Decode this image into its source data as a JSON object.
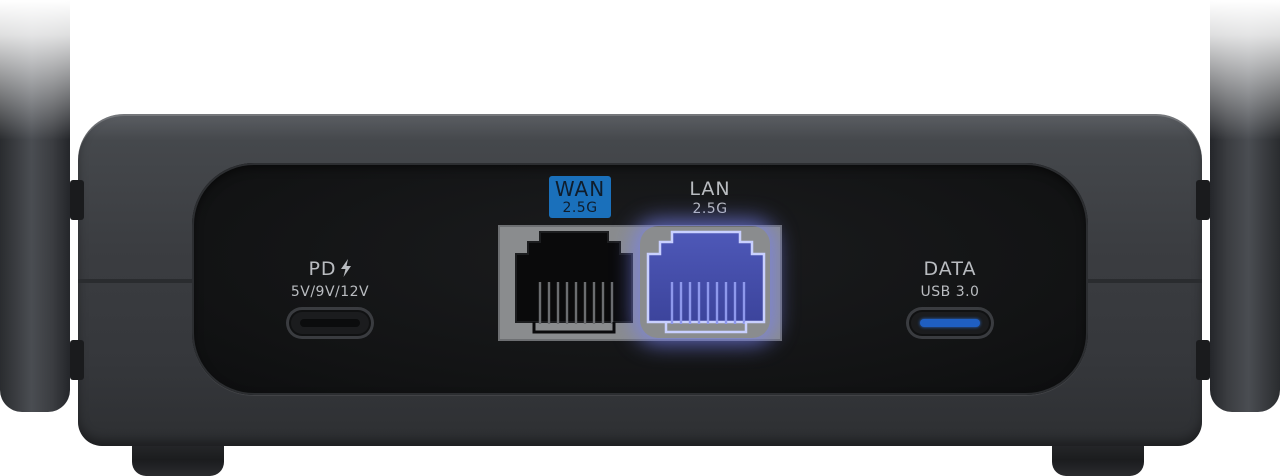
{
  "ports": {
    "pd": {
      "label": "PD",
      "sublabel": "5V/9V/12V",
      "icon": "lightning-icon"
    },
    "wan": {
      "label": "WAN",
      "sublabel": "2.5G",
      "badge_color": "#1a70bb"
    },
    "lan": {
      "label": "LAN",
      "sublabel": "2.5G",
      "glow_color": "#5a67d8"
    },
    "data": {
      "label": "DATA",
      "sublabel": "USB 3.0",
      "accent_color": "#1f5fc2"
    }
  },
  "colors": {
    "body": "#3b3d41",
    "panel": "#141516",
    "label_text": "#b9bcc0"
  }
}
